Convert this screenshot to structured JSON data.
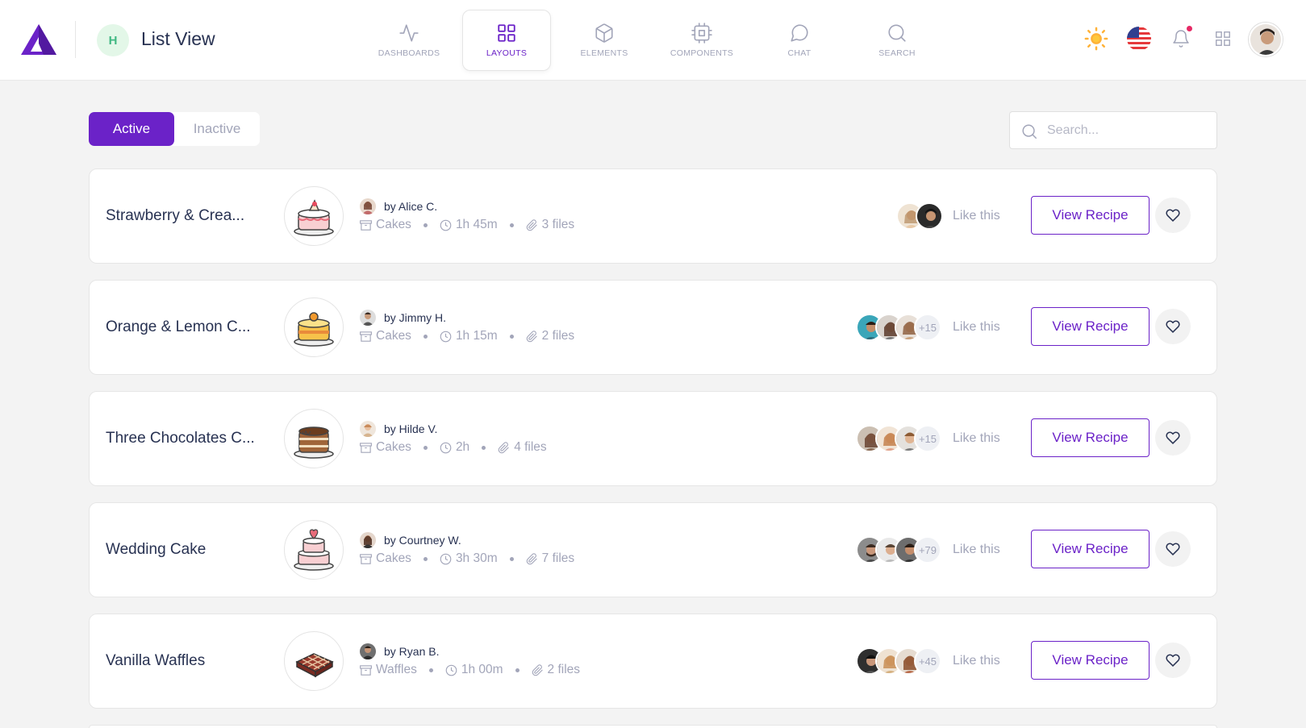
{
  "header": {
    "page_avatar_letter": "H",
    "page_title": "List View",
    "nav": [
      {
        "label": "DASHBOARDS",
        "icon": "activity-icon"
      },
      {
        "label": "LAYOUTS",
        "icon": "grid-icon",
        "active": true
      },
      {
        "label": "ELEMENTS",
        "icon": "box-icon"
      },
      {
        "label": "COMPONENTS",
        "icon": "cpu-icon"
      },
      {
        "label": "CHAT",
        "icon": "message-circle-icon"
      },
      {
        "label": "SEARCH",
        "icon": "search-icon"
      }
    ]
  },
  "toolbar": {
    "active_label": "Active",
    "inactive_label": "Inactive",
    "search_placeholder": "Search..."
  },
  "colors": {
    "accent": "#6b22c8",
    "muted": "#a2a5b9",
    "text": "#283252"
  },
  "like_label": "Like this",
  "view_label": "View Recipe",
  "recipes": [
    {
      "title": "Strawberry & Crea...",
      "author": "by Alice C.",
      "category": "Cakes",
      "time": "1h 45m",
      "files": "3 files",
      "likers_more": ""
    },
    {
      "title": "Orange & Lemon C...",
      "author": "by Jimmy H.",
      "category": "Cakes",
      "time": "1h 15m",
      "files": "2 files",
      "likers_more": "+15"
    },
    {
      "title": "Three Chocolates C...",
      "author": "by Hilde V.",
      "category": "Cakes",
      "time": "2h",
      "files": "4 files",
      "likers_more": "+15"
    },
    {
      "title": "Wedding Cake",
      "author": "by Courtney W.",
      "category": "Cakes",
      "time": "3h 30m",
      "files": "7 files",
      "likers_more": "+79"
    },
    {
      "title": "Vanilla Waffles",
      "author": "by Ryan B.",
      "category": "Waffles",
      "time": "1h 00m",
      "files": "2 files",
      "likers_more": "+45"
    }
  ]
}
